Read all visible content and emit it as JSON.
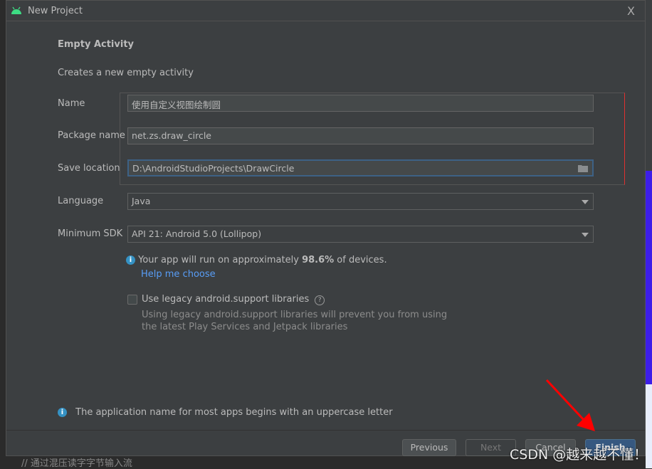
{
  "window": {
    "title": "New Project",
    "close_label": "X"
  },
  "template": {
    "heading": "Empty Activity",
    "description": "Creates a new empty activity"
  },
  "form": {
    "name": {
      "label": "Name",
      "value": "使用自定义视图绘制圆"
    },
    "package": {
      "label": "Package name",
      "value": "net.zs.draw_circle"
    },
    "location": {
      "label": "Save location",
      "value": "D:\\AndroidStudioProjects\\DrawCircle"
    },
    "language": {
      "label": "Language",
      "value": "Java"
    },
    "min_sdk": {
      "label": "Minimum SDK",
      "value": "API 21: Android 5.0 (Lollipop)"
    }
  },
  "sdk_info": {
    "prefix": "Your app will run on approximately ",
    "percent": "98.6%",
    "suffix": " of devices.",
    "help_link": "Help me choose"
  },
  "legacy": {
    "label": "Use legacy android.support libraries",
    "checked": false,
    "desc1": "Using legacy android.support libraries will prevent you from using",
    "desc2": "the latest Play Services and Jetpack libraries"
  },
  "footer_info": "The application name for most apps begins with an uppercase letter",
  "buttons": {
    "previous": "Previous",
    "next": "Next",
    "cancel": "Cancel",
    "finish": "Finish"
  },
  "watermark": "CSDN @越来越不懂！",
  "background_text": "// 通过混压读字字节输入流",
  "colors": {
    "accent": "#365880",
    "android": "#3ddc84",
    "annotation": "#ff0000"
  }
}
